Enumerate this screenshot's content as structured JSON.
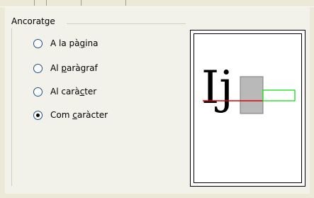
{
  "group": {
    "title": "Ancoratge",
    "options": [
      {
        "pre": "A la pà",
        "under": "g",
        "post": "ina",
        "checked": false
      },
      {
        "pre": "Al ",
        "under": "p",
        "post": "aràgraf",
        "checked": false
      },
      {
        "pre": "Al carà",
        "under": "c",
        "post": "ter",
        "checked": false
      },
      {
        "pre": "Com ",
        "under": "c",
        "post": "aràcter",
        "checked": true
      }
    ]
  },
  "preview": {
    "sample_text": "Ij",
    "baseline_color": "#e00000",
    "frame_color": "#00dd00",
    "box_color": "#b9b9b9"
  }
}
